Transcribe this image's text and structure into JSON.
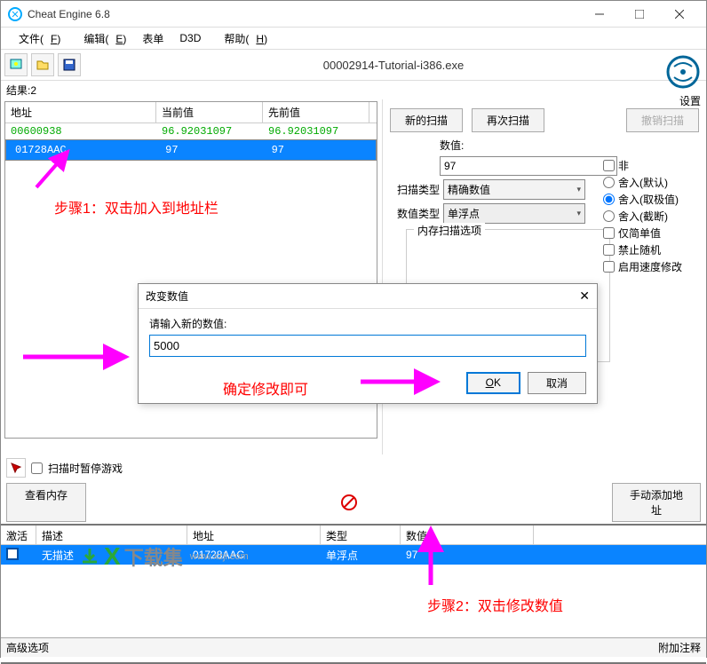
{
  "window": {
    "title": "Cheat Engine 6.8"
  },
  "menu": {
    "file": "文件(",
    "file_u": "F",
    "edit": "编辑(",
    "edit_u": "E",
    "table": "表单",
    "d3d": "D3D",
    "help": "帮助(",
    "help_u": "H"
  },
  "process_label": "00002914-Tutorial-i386.exe",
  "settings_label": "设置",
  "results_label": "结果:",
  "result_count": "2",
  "results_cols": {
    "addr": "地址",
    "cur": "当前值",
    "prev": "先前值"
  },
  "results_rows": [
    {
      "addr": "00600938",
      "cur": "96.92031097",
      "prev": "96.92031097",
      "cls": "green"
    },
    {
      "addr": "01728AAC",
      "cur": "97",
      "prev": "97",
      "cls": "sel"
    }
  ],
  "right": {
    "new_scan": "新的扫描",
    "next_scan": "再次扫描",
    "undo": "撤销扫描",
    "value_label": "数值:",
    "value": "97",
    "scan_type_label": "扫描类型",
    "scan_type": "精确数值",
    "value_type_label": "数值类型",
    "value_type": "单浮点",
    "mem_opts_label": "内存扫描选项"
  },
  "radios": {
    "not": "非",
    "round_def": "舍入(默认)",
    "round_ext": "舍入(取极值)",
    "round_trunc": "舍入(截断)",
    "simple_only": "仅简单值",
    "no_random": "禁止随机",
    "speed": "启用速度修改"
  },
  "pause_label": "扫描时暂停游戏",
  "view_mem": "查看内存",
  "add_addr": "手动添加地址",
  "cheat_cols": {
    "act": "激活",
    "desc": "描述",
    "addr": "地址",
    "type": "类型",
    "val": "数值"
  },
  "cheat_row": {
    "desc": "无描述",
    "addr": "01728AAC",
    "type": "单浮点",
    "val": "97"
  },
  "bottom": {
    "adv": "高级选项",
    "notes": "附加注释"
  },
  "dialog": {
    "title": "改变数值",
    "prompt": "请输入新的数值:",
    "value": "5000",
    "ok": "OK",
    "ok_u": "O",
    "cancel": "取消"
  },
  "annotations": {
    "step1": "步骤1：双击加入到地址栏",
    "confirm": "确定修改即可",
    "step2": "步骤2：双击修改数值"
  },
  "watermark": {
    "brand": "下载集",
    "url": "www.xzji.com"
  }
}
